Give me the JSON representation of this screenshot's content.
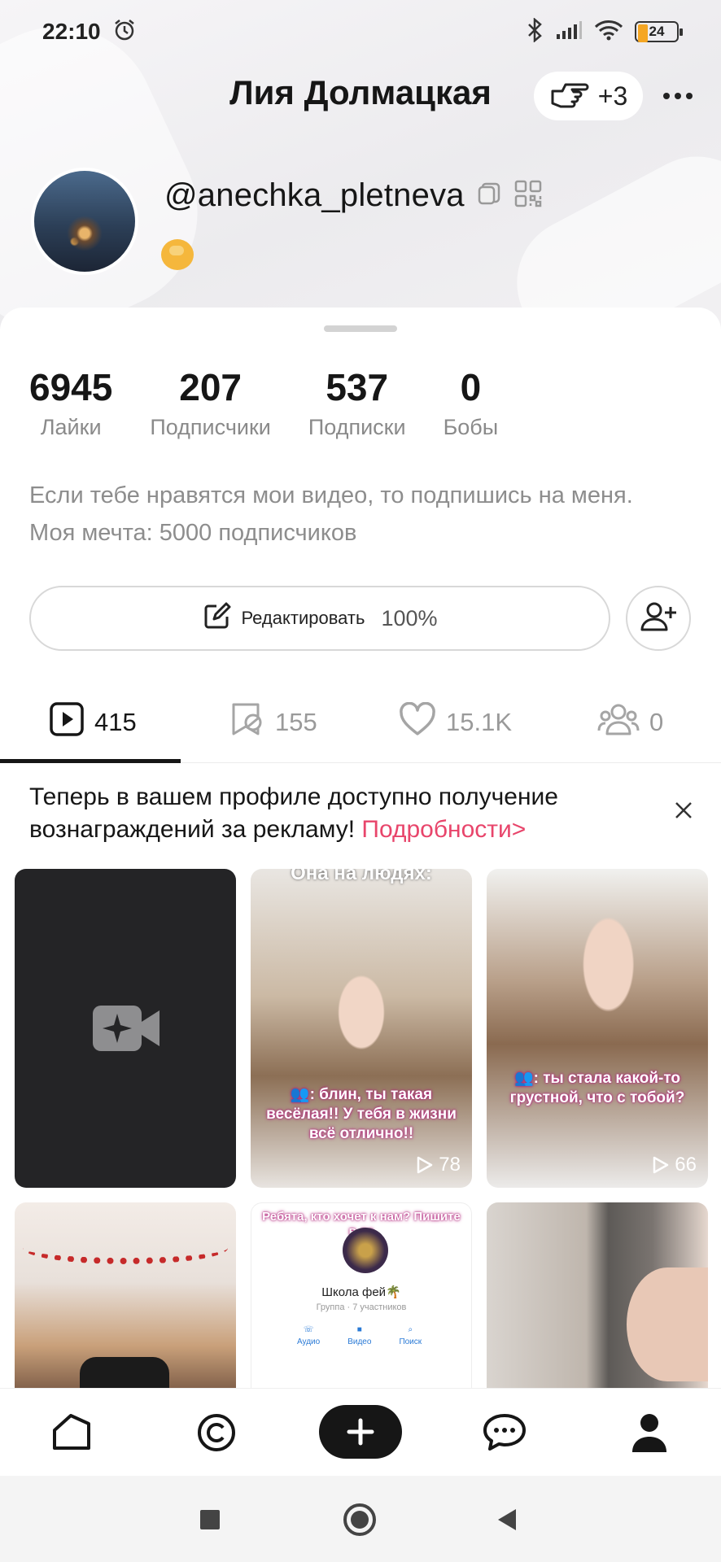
{
  "status_bar": {
    "time": "22:10",
    "battery_level": "24"
  },
  "header": {
    "title": "Лия Долмацкая",
    "visitors_count": "+3"
  },
  "profile": {
    "handle": "@anechka_pletneva",
    "bio": "Если тебе нравятся мои видео, то подпишись на меня. Моя мечта: 5000 подписчиков"
  },
  "stats": [
    {
      "value": "6945",
      "label": "Лайки"
    },
    {
      "value": "207",
      "label": "Подписчики"
    },
    {
      "value": "537",
      "label": "Подписки"
    },
    {
      "value": "0",
      "label": "Бобы"
    }
  ],
  "actions": {
    "edit_label": "Редактировать",
    "edit_progress": "100%"
  },
  "tabs": [
    {
      "icon": "video-icon",
      "count": "415",
      "active": true
    },
    {
      "icon": "reposts-icon",
      "count": "155",
      "active": false
    },
    {
      "icon": "heart-icon",
      "count": "15.1K",
      "active": false
    },
    {
      "icon": "group-icon",
      "count": "0",
      "active": false
    }
  ],
  "promo": {
    "text": "Теперь в вашем профиле доступно получение вознаграждений за рекламу!",
    "link": "Подробности>"
  },
  "videos": [
    {
      "type": "draft"
    },
    {
      "type": "video",
      "top_text": "Она на людях:",
      "caption": "👥: блин, ты такая весёлая!! У тебя в жизни всё отлично!!",
      "views": "78"
    },
    {
      "type": "video",
      "caption": "👥: ты стала какой-то грустной, что с тобой?",
      "views": "66"
    },
    {
      "type": "video"
    },
    {
      "type": "video",
      "caption": "Ребята, кто хочет к нам? Пишите в лс",
      "group_name": "Школа фей🌴",
      "group_sub": "Группа · 7 участников",
      "group_actions": [
        "Аудио",
        "Видео",
        "Поиск"
      ]
    },
    {
      "type": "video"
    }
  ],
  "colors": {
    "accent_link": "#e8456b",
    "text": "#161616",
    "muted": "#8d8d8d",
    "battery": "#f5a623"
  }
}
